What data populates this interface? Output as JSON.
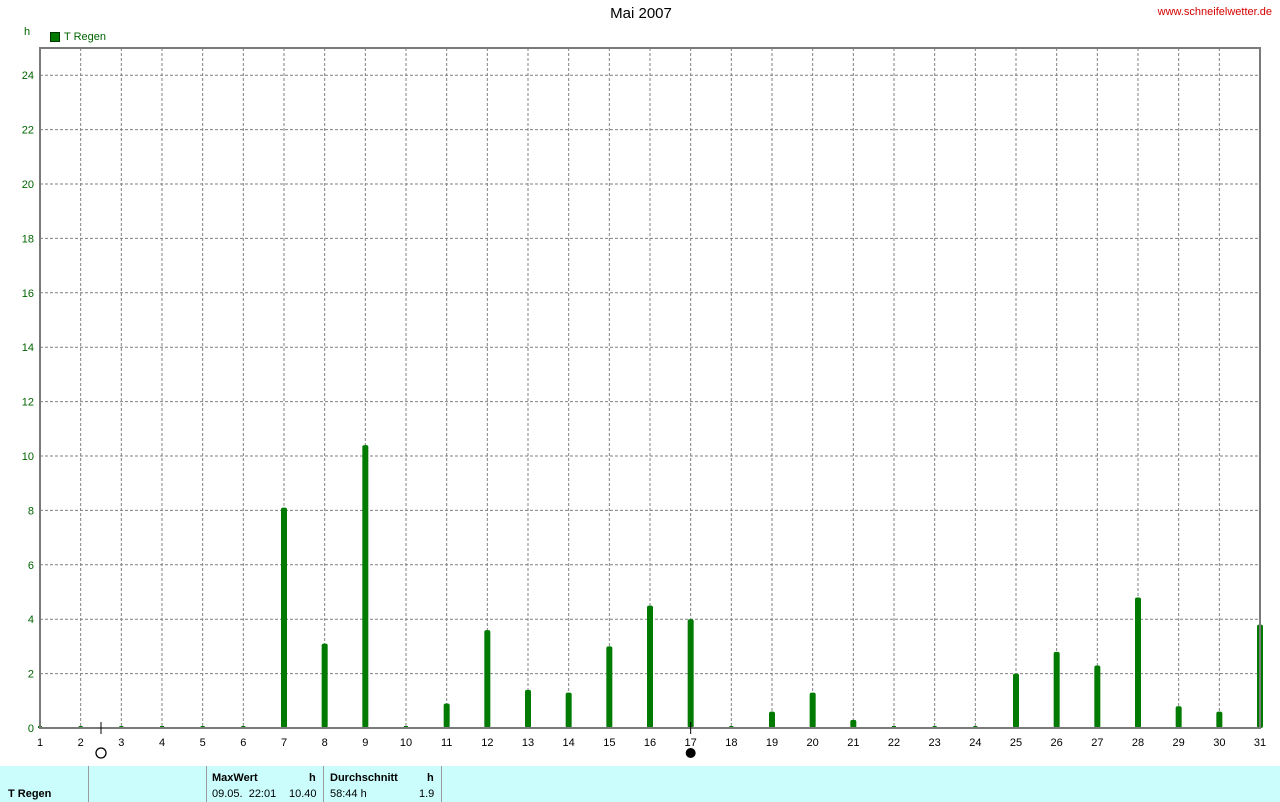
{
  "header": {
    "title": "Mai 2007",
    "site": "www.schneifelwetter.de",
    "unit": "h"
  },
  "chart_data": {
    "type": "bar",
    "title": "Mai 2007",
    "ylabel": "h",
    "ylim": [
      0,
      25
    ],
    "yticks": [
      0,
      2,
      4,
      6,
      8,
      10,
      12,
      14,
      16,
      18,
      20,
      22,
      24
    ],
    "categories": [
      "1",
      "2",
      "3",
      "4",
      "5",
      "6",
      "7",
      "8",
      "9",
      "10",
      "11",
      "12",
      "13",
      "14",
      "15",
      "16",
      "17",
      "18",
      "19",
      "20",
      "21",
      "22",
      "23",
      "24",
      "25",
      "26",
      "27",
      "28",
      "29",
      "30",
      "31"
    ],
    "series": [
      {
        "name": "T Regen",
        "color": "#007a00",
        "values": [
          0,
          0,
          0,
          0,
          0,
          0,
          8.1,
          3.1,
          10.4,
          0,
          0.9,
          3.6,
          1.4,
          1.3,
          3.0,
          4.5,
          4.0,
          0,
          0.6,
          1.3,
          0.3,
          0,
          0,
          0,
          2.0,
          2.8,
          2.3,
          4.8,
          0.8,
          0.6,
          3.8
        ]
      }
    ],
    "grid": true,
    "legend": "top-left",
    "moon_phases": [
      {
        "day": 2.5,
        "phase": "full-moon"
      },
      {
        "day": 17,
        "phase": "new-moon"
      }
    ]
  },
  "stats": {
    "series_label": "T Regen",
    "max_header": "MaxWert",
    "max_unit": "h",
    "max_time": "09.05.  22:01",
    "max_value": "10.40",
    "avg_header": "Durchschnitt",
    "avg_unit": "h",
    "avg_total": "58:44 h",
    "avg_value": "1.9"
  }
}
